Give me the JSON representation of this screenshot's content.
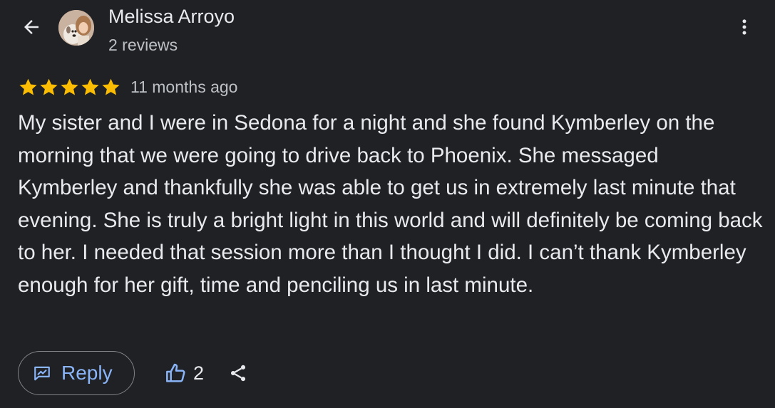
{
  "header": {
    "back_icon": "arrow-back-icon",
    "reviewer_name": "Melissa Arroyo",
    "reviewer_meta": "2 reviews",
    "avatar_icon": "avatar",
    "more_icon": "more-vert-icon"
  },
  "review": {
    "rating": 5,
    "max_rating": 5,
    "star_color": "#fbbc04",
    "age": "11 months ago",
    "text": "My sister and I were in Sedona for a night and she found Kymberley on the morning that we were going to drive back to Phoenix. She messaged Kymberley and thankfully she was able to get us in extremely last minute that evening. She is truly a bright light in this world and will definitely be coming back to her. I needed that session more than I thought I did. I can’t thank Kymberley enough for her gift, time and penciling us in last minute."
  },
  "actions": {
    "reply_label": "Reply",
    "reply_icon": "reply-icon",
    "like_icon": "thumb-up-icon",
    "like_count": "2",
    "share_icon": "share-icon",
    "accent_color": "#8ab4f8"
  }
}
